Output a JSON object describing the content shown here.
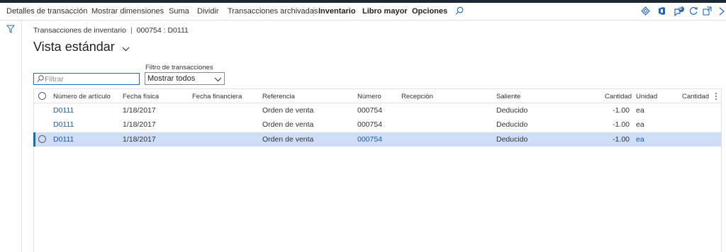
{
  "toolbar": {
    "items": [
      "Detalles de transacción",
      "Mostrar dimensiones",
      "Suma",
      "Dividir",
      "Transacciones archivadas",
      "Inventario",
      "Libro mayor",
      "Opciones"
    ],
    "notification_count": "0",
    "icons": [
      "search-icon",
      "diamond-icon",
      "office-icon",
      "notification-icon",
      "refresh-icon",
      "open-in-new-icon",
      "close-icon"
    ]
  },
  "sidebar": {
    "icon": "filter-icon"
  },
  "breadcrumb": {
    "page": "Transacciones de inventario",
    "separator": "|",
    "record": "000754 : D0111"
  },
  "view": {
    "title": "Vista estándar"
  },
  "filter": {
    "placeholder": "Filtrar",
    "value": ""
  },
  "transaction_filter": {
    "label": "Filtro de transacciones",
    "selected": "Mostrar todos"
  },
  "grid": {
    "columns": [
      "Número de artículo",
      "Fecha física",
      "Fecha financiera",
      "Referencia",
      "Número",
      "Recepción",
      "Saliente",
      "Cantidad",
      "Unidad",
      "Cantidad"
    ],
    "rows": [
      {
        "item": "D0111",
        "physical_date": "1/18/2017",
        "financial_date": "",
        "reference": "Orden de venta",
        "number": "000754",
        "receipt": "",
        "issue": "Deducido",
        "quantity": "-1.00",
        "unit": "ea",
        "quantity2": "",
        "selected": false
      },
      {
        "item": "D0111",
        "physical_date": "1/18/2017",
        "financial_date": "",
        "reference": "Orden de venta",
        "number": "000754",
        "receipt": "",
        "issue": "Deducido",
        "quantity": "-1.00",
        "unit": "ea",
        "quantity2": "",
        "selected": false
      },
      {
        "item": "D0111",
        "physical_date": "1/18/2017",
        "financial_date": "",
        "reference": "Orden de venta",
        "number": "000754",
        "receipt": "",
        "issue": "Deducido",
        "quantity": "-1.00",
        "unit": "ea",
        "quantity2": "",
        "selected": true
      }
    ]
  },
  "colors": {
    "accent": "#0f6cbd",
    "link": "#1d5aa8",
    "selected_row": "#cfdef7",
    "top_strip": "#1b2633"
  }
}
